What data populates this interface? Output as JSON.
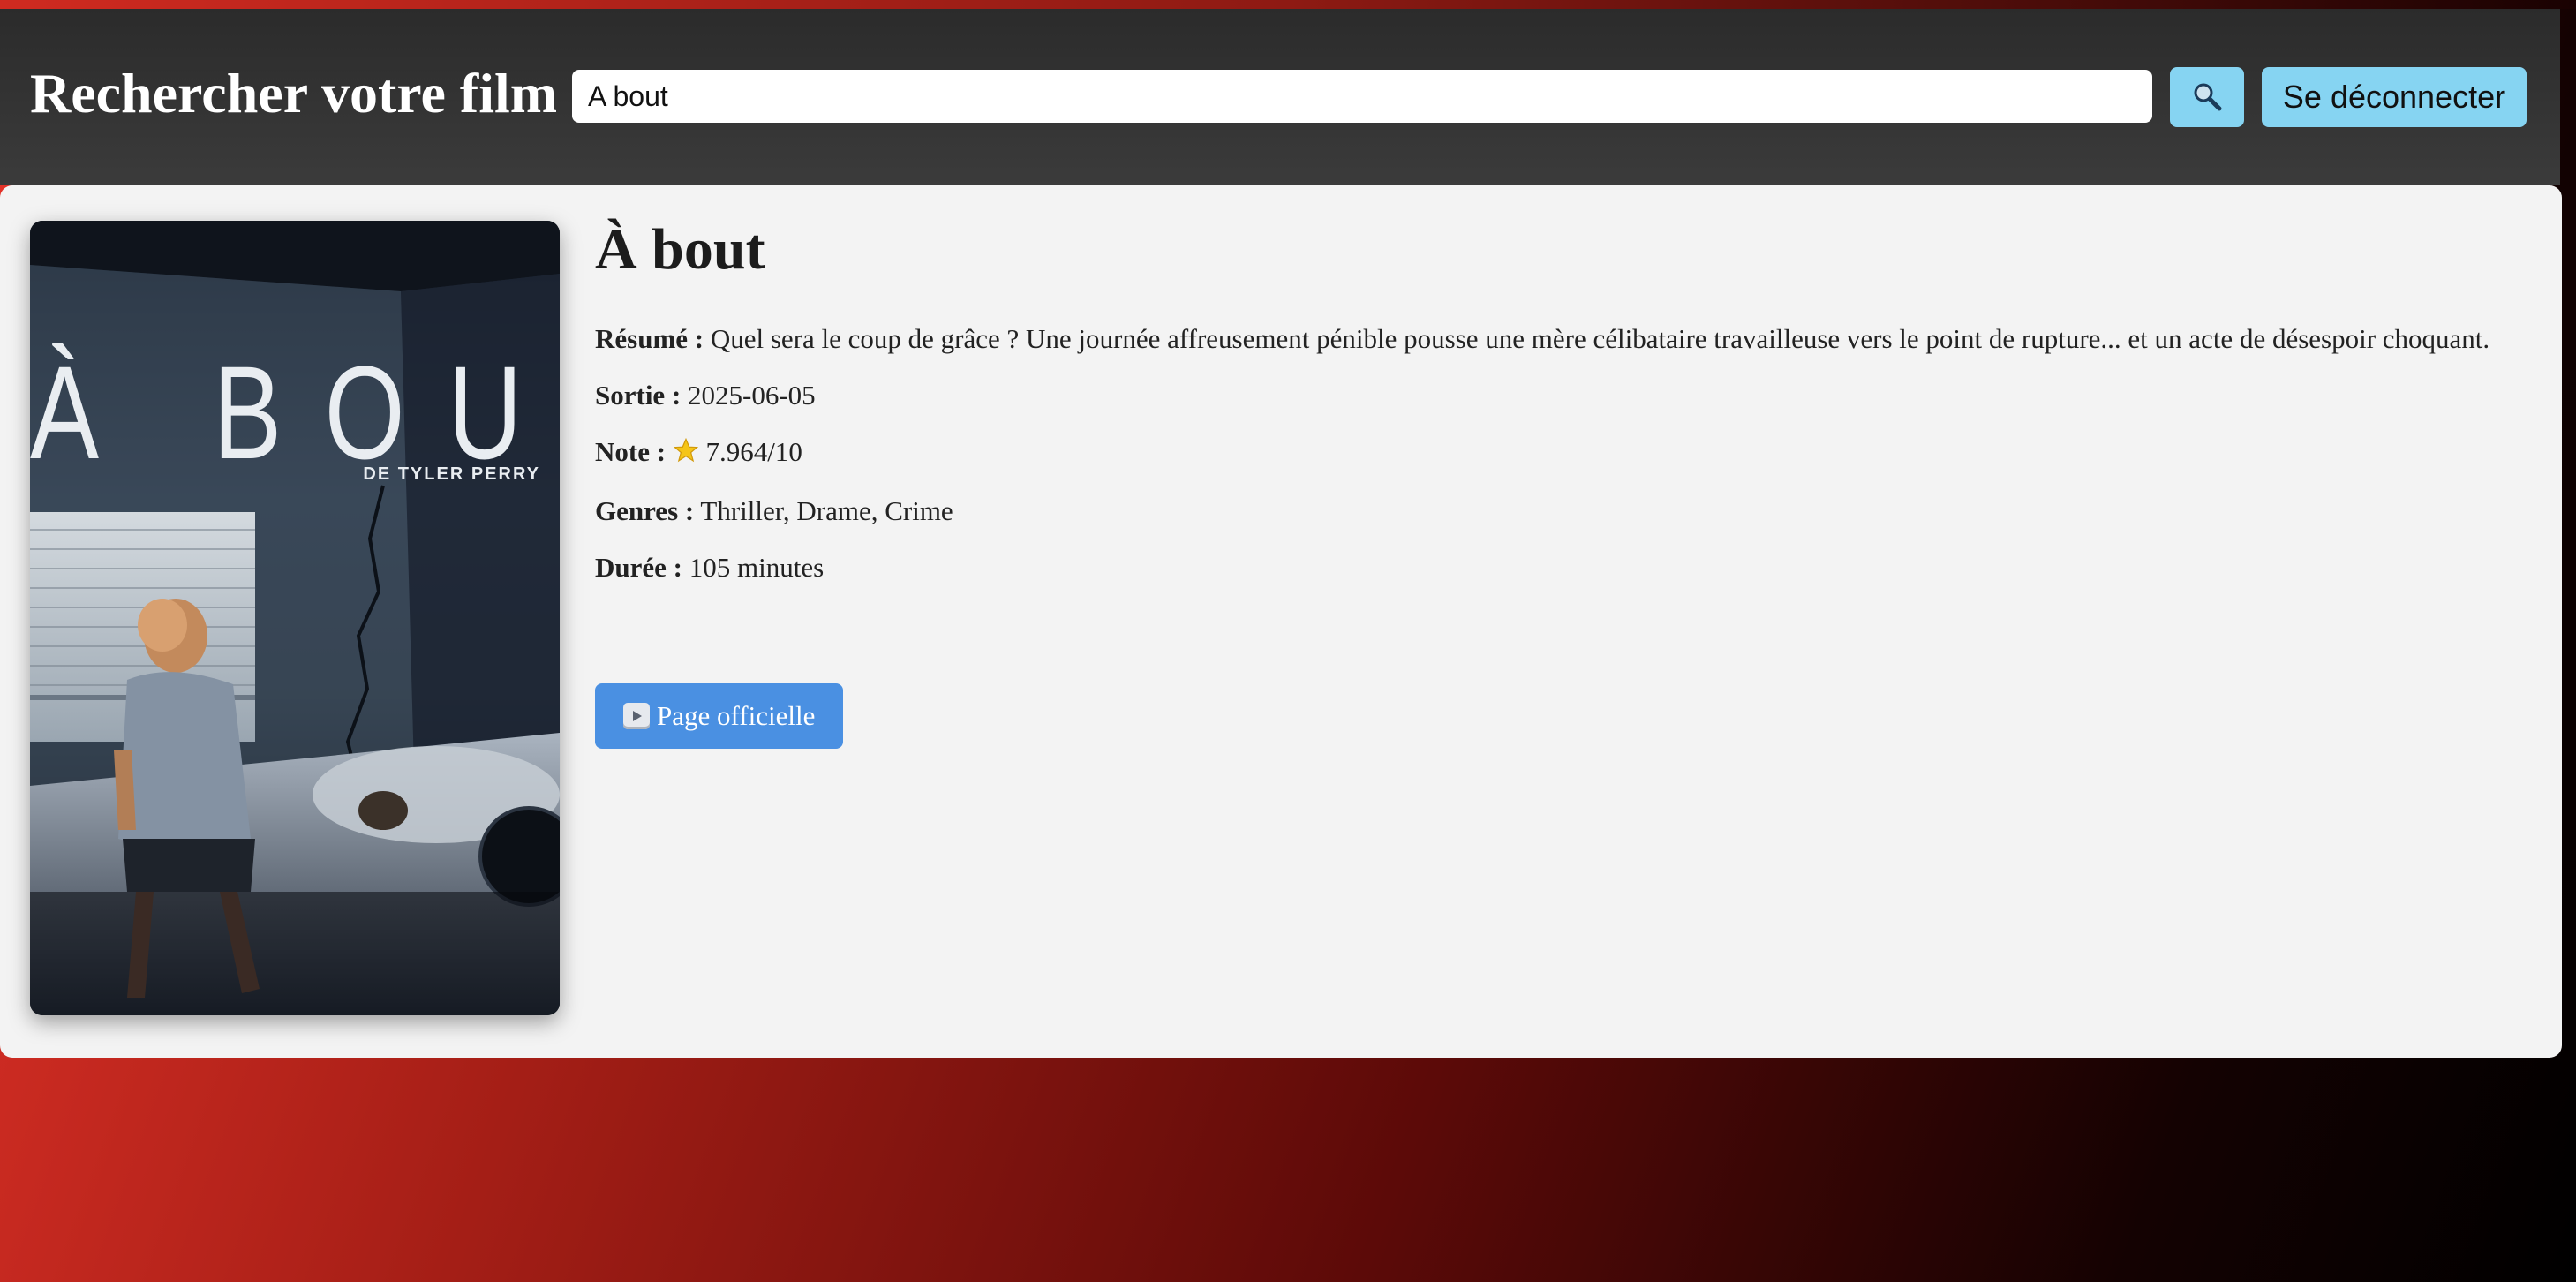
{
  "header": {
    "title": "Rechercher votre film",
    "search_value": "A bout",
    "search_icon": "magnifier-icon",
    "logout_label": "Se déconnecter"
  },
  "poster": {
    "title_text": "À BOUT",
    "byline": "DE TYLER PERRY"
  },
  "movie": {
    "title": "À bout",
    "summary_label": "Résumé :",
    "summary": "Quel sera le coup de grâce ? Une journée affreusement pénible pousse une mère célibataire travailleuse vers le point de rupture... et un acte de désespoir choquant.",
    "release_label": "Sortie :",
    "release": "2025-06-05",
    "rating_label": "Note :",
    "rating_icon": "star-icon",
    "rating": "7.964/10",
    "genres_label": "Genres :",
    "genres": "Thriller, Drame, Crime",
    "duration_label": "Durée :",
    "duration": "105 minutes",
    "official_icon": "play-button-icon",
    "official_label": "Page officielle"
  },
  "colors": {
    "button_light_blue": "#86d4f2",
    "button_blue": "#4a90e2",
    "header_dark": "#333333",
    "panel_bg": "#f3f3f3",
    "bg_red": "#e8342a",
    "star": "#f5c518"
  }
}
